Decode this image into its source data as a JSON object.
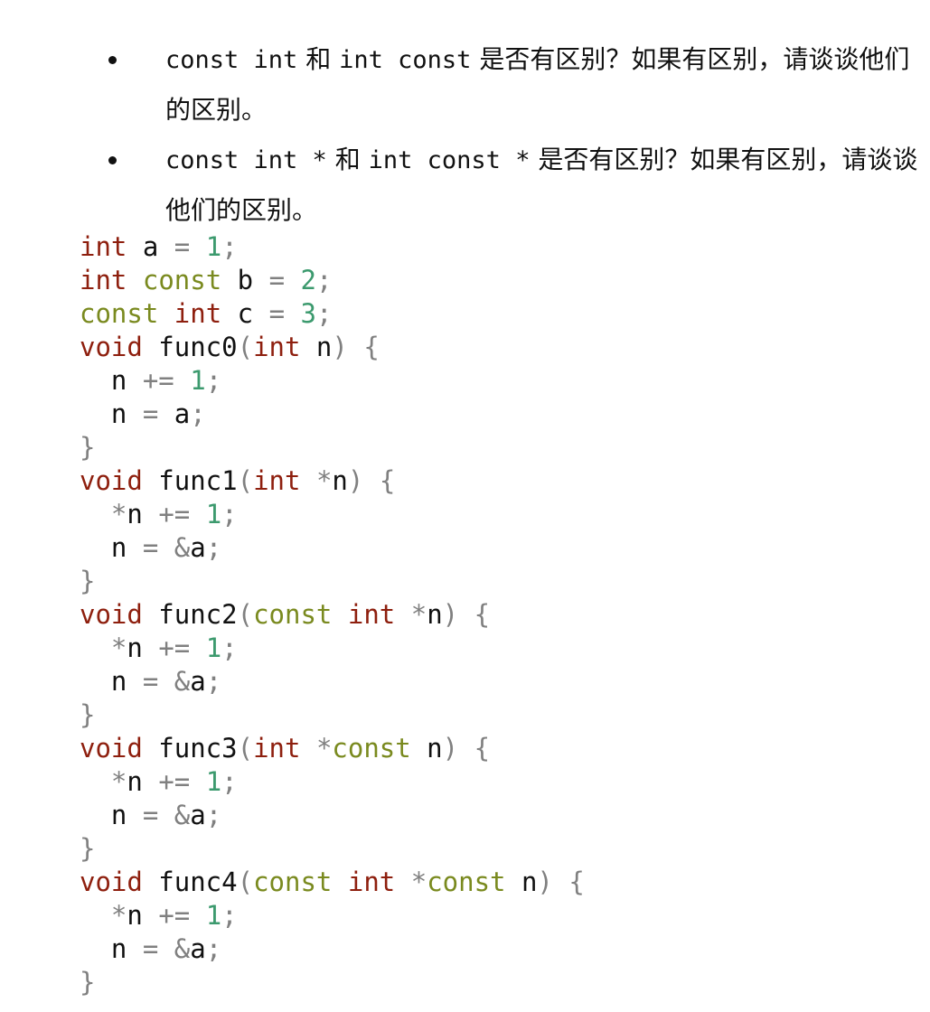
{
  "questions": [
    {
      "code_a": "const int",
      "join": "和",
      "code_b": "int const",
      "text": "是否有区别？如果有区别，请谈谈他们的区别。"
    },
    {
      "code_a": "const int *",
      "join": "和",
      "code_b": "int const *",
      "text": "是否有区别？如果有区别，请谈谈他们的区别。"
    }
  ],
  "code_lines": [
    [
      [
        "kw",
        "int"
      ],
      [
        "id",
        " a "
      ],
      [
        "pun",
        "="
      ],
      [
        "id",
        " "
      ],
      [
        "num",
        "1"
      ],
      [
        "pun",
        ";"
      ]
    ],
    [
      [
        "kw",
        "int"
      ],
      [
        "id",
        " "
      ],
      [
        "ty",
        "const"
      ],
      [
        "id",
        " b "
      ],
      [
        "pun",
        "="
      ],
      [
        "id",
        " "
      ],
      [
        "num",
        "2"
      ],
      [
        "pun",
        ";"
      ]
    ],
    [
      [
        "ty",
        "const"
      ],
      [
        "id",
        " "
      ],
      [
        "kw",
        "int"
      ],
      [
        "id",
        " c "
      ],
      [
        "pun",
        "="
      ],
      [
        "id",
        " "
      ],
      [
        "num",
        "3"
      ],
      [
        "pun",
        ";"
      ]
    ],
    [
      [
        "kw",
        "void"
      ],
      [
        "id",
        " func0"
      ],
      [
        "pun",
        "("
      ],
      [
        "kw",
        "int"
      ],
      [
        "id",
        " n"
      ],
      [
        "pun",
        ")"
      ],
      [
        "id",
        " "
      ],
      [
        "pun",
        "{"
      ]
    ],
    [
      [
        "id",
        "  n "
      ],
      [
        "pun",
        "+="
      ],
      [
        "id",
        " "
      ],
      [
        "num",
        "1"
      ],
      [
        "pun",
        ";"
      ]
    ],
    [
      [
        "id",
        "  n "
      ],
      [
        "pun",
        "="
      ],
      [
        "id",
        " a"
      ],
      [
        "pun",
        ";"
      ]
    ],
    [
      [
        "pun",
        "}"
      ]
    ],
    [
      [
        "kw",
        "void"
      ],
      [
        "id",
        " func1"
      ],
      [
        "pun",
        "("
      ],
      [
        "kw",
        "int"
      ],
      [
        "id",
        " "
      ],
      [
        "pun",
        "*"
      ],
      [
        "id",
        "n"
      ],
      [
        "pun",
        ")"
      ],
      [
        "id",
        " "
      ],
      [
        "pun",
        "{"
      ]
    ],
    [
      [
        "id",
        "  "
      ],
      [
        "pun",
        "*"
      ],
      [
        "id",
        "n "
      ],
      [
        "pun",
        "+="
      ],
      [
        "id",
        " "
      ],
      [
        "num",
        "1"
      ],
      [
        "pun",
        ";"
      ]
    ],
    [
      [
        "id",
        "  n "
      ],
      [
        "pun",
        "="
      ],
      [
        "id",
        " "
      ],
      [
        "pun",
        "&"
      ],
      [
        "id",
        "a"
      ],
      [
        "pun",
        ";"
      ]
    ],
    [
      [
        "pun",
        "}"
      ]
    ],
    [
      [
        "kw",
        "void"
      ],
      [
        "id",
        " func2"
      ],
      [
        "pun",
        "("
      ],
      [
        "ty",
        "const"
      ],
      [
        "id",
        " "
      ],
      [
        "kw",
        "int"
      ],
      [
        "id",
        " "
      ],
      [
        "pun",
        "*"
      ],
      [
        "id",
        "n"
      ],
      [
        "pun",
        ")"
      ],
      [
        "id",
        " "
      ],
      [
        "pun",
        "{"
      ]
    ],
    [
      [
        "id",
        "  "
      ],
      [
        "pun",
        "*"
      ],
      [
        "id",
        "n "
      ],
      [
        "pun",
        "+="
      ],
      [
        "id",
        " "
      ],
      [
        "num",
        "1"
      ],
      [
        "pun",
        ";"
      ]
    ],
    [
      [
        "id",
        "  n "
      ],
      [
        "pun",
        "="
      ],
      [
        "id",
        " "
      ],
      [
        "pun",
        "&"
      ],
      [
        "id",
        "a"
      ],
      [
        "pun",
        ";"
      ]
    ],
    [
      [
        "pun",
        "}"
      ]
    ],
    [
      [
        "kw",
        "void"
      ],
      [
        "id",
        " func3"
      ],
      [
        "pun",
        "("
      ],
      [
        "kw",
        "int"
      ],
      [
        "id",
        " "
      ],
      [
        "pun",
        "*"
      ],
      [
        "ty",
        "const"
      ],
      [
        "id",
        " n"
      ],
      [
        "pun",
        ")"
      ],
      [
        "id",
        " "
      ],
      [
        "pun",
        "{"
      ]
    ],
    [
      [
        "id",
        "  "
      ],
      [
        "pun",
        "*"
      ],
      [
        "id",
        "n "
      ],
      [
        "pun",
        "+="
      ],
      [
        "id",
        " "
      ],
      [
        "num",
        "1"
      ],
      [
        "pun",
        ";"
      ]
    ],
    [
      [
        "id",
        "  n "
      ],
      [
        "pun",
        "="
      ],
      [
        "id",
        " "
      ],
      [
        "pun",
        "&"
      ],
      [
        "id",
        "a"
      ],
      [
        "pun",
        ";"
      ]
    ],
    [
      [
        "pun",
        "}"
      ]
    ],
    [
      [
        "kw",
        "void"
      ],
      [
        "id",
        " func4"
      ],
      [
        "pun",
        "("
      ],
      [
        "ty",
        "const"
      ],
      [
        "id",
        " "
      ],
      [
        "kw",
        "int"
      ],
      [
        "id",
        " "
      ],
      [
        "pun",
        "*"
      ],
      [
        "ty",
        "const"
      ],
      [
        "id",
        " n"
      ],
      [
        "pun",
        ")"
      ],
      [
        "id",
        " "
      ],
      [
        "pun",
        "{"
      ]
    ],
    [
      [
        "id",
        "  "
      ],
      [
        "pun",
        "*"
      ],
      [
        "id",
        "n "
      ],
      [
        "pun",
        "+="
      ],
      [
        "id",
        " "
      ],
      [
        "num",
        "1"
      ],
      [
        "pun",
        ";"
      ]
    ],
    [
      [
        "id",
        "  n "
      ],
      [
        "pun",
        "="
      ],
      [
        "id",
        " "
      ],
      [
        "pun",
        "&"
      ],
      [
        "id",
        "a"
      ],
      [
        "pun",
        ";"
      ]
    ],
    [
      [
        "pun",
        "}"
      ]
    ]
  ]
}
